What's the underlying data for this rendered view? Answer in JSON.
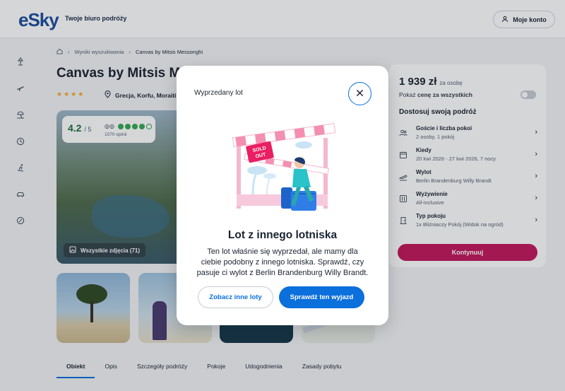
{
  "header": {
    "logo": "eSky",
    "tagline": "Twoje biuro podróży",
    "account_label": "Moje konto"
  },
  "sidebar": {
    "icons": [
      "package-icon",
      "flight-icon",
      "beach-icon",
      "clock-icon",
      "ski-icon",
      "car-icon",
      "discount-icon"
    ]
  },
  "breadcrumb": {
    "items": [
      "Wyniki wyszukiwania",
      "Canvas by Mitsis Messonghi"
    ]
  },
  "hotel": {
    "title": "Canvas by Mitsis Messonghi",
    "stars": "★★★★",
    "location": "Grecja, Korfu, Moraitika",
    "rating": "4.2",
    "rating_max": "/ 5",
    "rating_dots_filled": 4,
    "rating_dots_total": 5,
    "reviews": "1070 opinii",
    "all_photos_label": "Wszystkie zdjęcia (71)"
  },
  "tabs": [
    "Obiekt",
    "Opis",
    "Szczegóły podróży",
    "Pokoje",
    "Udogodnienia",
    "Zasady pobytu"
  ],
  "booking": {
    "price": "1 939 zł",
    "price_unit": "za osobę",
    "price_all_prefix": "Pokaż ",
    "price_all_bold": "cenę za wszystkich",
    "heading": "Dostosuj swoją podróż",
    "options": [
      {
        "title": "Goście i liczba pokoi",
        "value": "2 osoby, 1 pokój",
        "icon": "guests-icon"
      },
      {
        "title": "Kiedy",
        "value": "20 kwi 2026 - 27 kwi 2026, 7 nocy",
        "icon": "calendar-icon"
      },
      {
        "title": "Wylot",
        "value": "Berlin Brandenburg Willy Brandt",
        "icon": "departure-icon"
      },
      {
        "title": "Wyżywienie",
        "value": "All-inclusive",
        "icon": "meal-icon"
      },
      {
        "title": "Typ pokoju",
        "value": "1x Bliźniaczy Pokój (Widok na ogród)",
        "icon": "door-icon"
      }
    ],
    "continue_label": "Kontynuuj"
  },
  "modal": {
    "label": "Wyprzedany lot",
    "illustration_text": "SOLD OUT",
    "title": "Lot z innego lotniska",
    "body": "Ten lot właśnie się wyprzedał, ale mamy dla ciebie podobny z innego lotniska. Sprawdź, czy pasuje ci wylot z Berlin Brandenburg Willy Brandt.",
    "secondary_button": "Zobacz inne loty",
    "primary_button": "Sprawdź ten wyjazd"
  },
  "colors": {
    "brand_blue": "#0b6fdc",
    "cta_magenta": "#c2185b",
    "rating_green": "#34a853"
  }
}
